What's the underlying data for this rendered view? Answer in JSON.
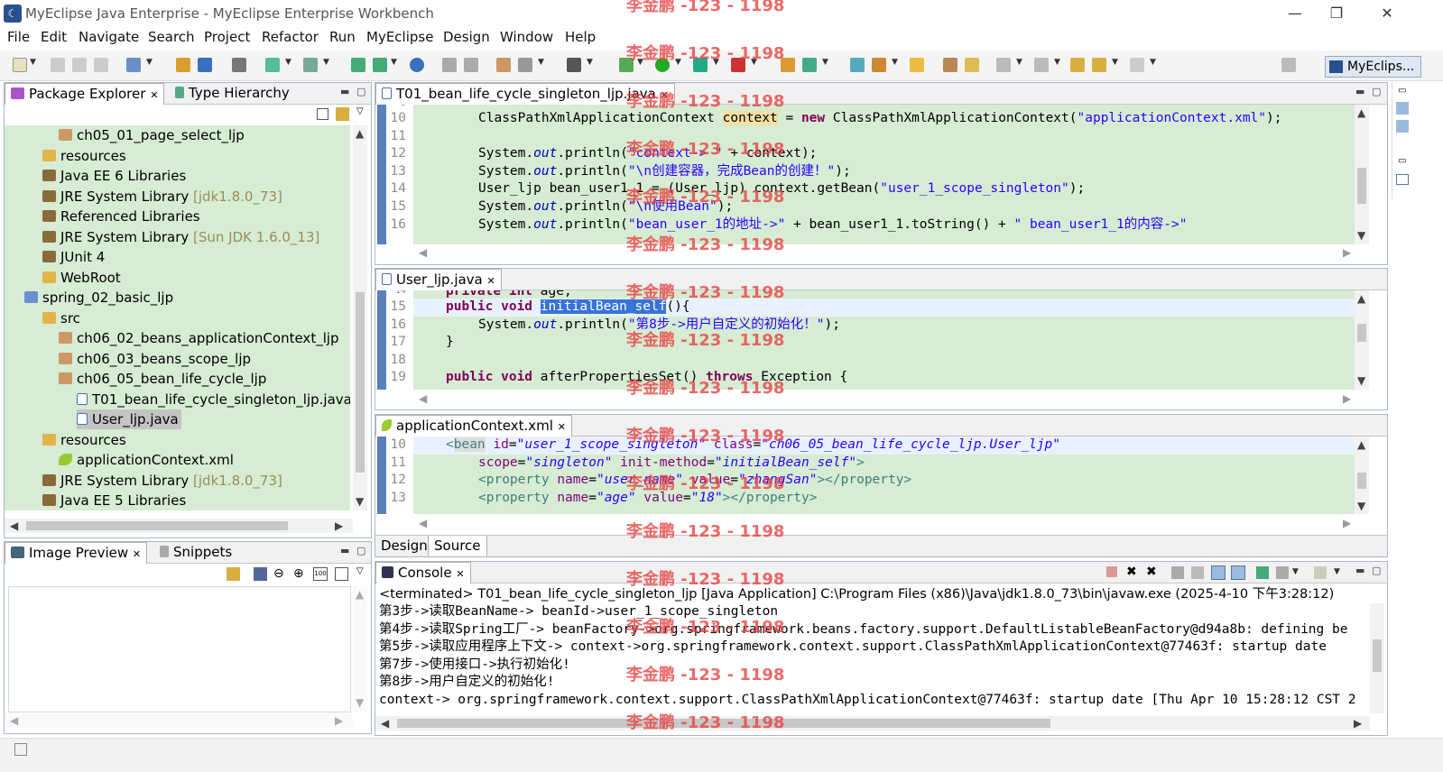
{
  "window": {
    "title": "MyEclipse Java Enterprise - MyEclipse Enterprise Workbench",
    "minimize": "—",
    "restore": "❐",
    "close": "✕"
  },
  "menu": [
    "File",
    "Edit",
    "Navigate",
    "Search",
    "Project",
    "Refactor",
    "Run",
    "MyEclipse",
    "Design",
    "Window",
    "Help"
  ],
  "perspective": "MyEclips...",
  "watermark": "李金鹏 -123 - 1198",
  "explorer": {
    "tabs": [
      "Package Explorer",
      "Type Hierarchy"
    ],
    "items": [
      {
        "label": "ch05_01_page_select_ljp",
        "extra": "",
        "icon": "package"
      },
      {
        "label": "resources",
        "extra": "",
        "icon": "folder"
      },
      {
        "label": "Java EE 6 Libraries",
        "extra": "",
        "icon": "library"
      },
      {
        "label": "JRE System Library",
        "extra": "[jdk1.8.0_73]",
        "icon": "library"
      },
      {
        "label": "Referenced Libraries",
        "extra": "",
        "icon": "library"
      },
      {
        "label": "JRE System Library",
        "extra": "[Sun JDK 1.6.0_13]",
        "icon": "library"
      },
      {
        "label": "JUnit 4",
        "extra": "",
        "icon": "library"
      },
      {
        "label": "WebRoot",
        "extra": "",
        "icon": "folder"
      },
      {
        "label": "spring_02_basic_ljp",
        "extra": "",
        "icon": "project"
      },
      {
        "label": "src",
        "extra": "",
        "icon": "folder"
      },
      {
        "label": "ch06_02_beans_applicationContext_ljp",
        "extra": "",
        "icon": "package"
      },
      {
        "label": "ch06_03_beans_scope_ljp",
        "extra": "",
        "icon": "package"
      },
      {
        "label": "ch06_05_bean_life_cycle_ljp",
        "extra": "",
        "icon": "package"
      },
      {
        "label": "T01_bean_life_cycle_singleton_ljp.java",
        "extra": "",
        "icon": "java"
      },
      {
        "label": "User_ljp.java",
        "extra": "",
        "icon": "java"
      },
      {
        "label": "resources",
        "extra": "",
        "icon": "folder"
      },
      {
        "label": "applicationContext.xml",
        "extra": "",
        "icon": "xml"
      },
      {
        "label": "JRE System Library",
        "extra": "[jdk1.8.0_73]",
        "icon": "library"
      },
      {
        "label": "Java EE 5 Libraries",
        "extra": "",
        "icon": "library"
      }
    ]
  },
  "preview": {
    "tabs": [
      "Image Preview",
      "Snippets"
    ]
  },
  "editor1": {
    "tab": "T01_bean_life_cycle_singleton_ljp.java",
    "lines": [
      "10",
      "11",
      "12",
      "13",
      "14",
      "15",
      "16"
    ],
    "code": [
      "ClassPathXmlApplicationContext context = new ClassPathXmlApplicationContext(\"applicationContext.xml\");",
      "",
      "System.out.println(\"context-> \" + context);",
      "System.out.println(\"\\n创建容器，完成Bean的创建！\");",
      "User_ljp bean_user1_1 = (User_ljp) context.getBean(\"user_1_scope_singleton\");",
      "System.out.println(\"\\n使用Bean\");",
      "System.out.println(\"bean_user_1的地址->\" + bean_user1_1.toString() + \" bean_user1_1的内容->\""
    ]
  },
  "editor2": {
    "tab": "User_ljp.java",
    "lines": [
      "15",
      "16",
      "17",
      "18",
      "19"
    ],
    "code": [
      "public void initialBean_self(){",
      "    System.out.println(\"第8步->用户自定义的初始化！\");",
      "}",
      "",
      "public void afterPropertiesSet() throws Exception {"
    ]
  },
  "editor3": {
    "tab": "applicationContext.xml",
    "lines": [
      "10",
      "11",
      "12",
      "13"
    ],
    "code": [
      "<bean id=\"user_1_scope_singleton\" class=\"ch06_05_bean_life_cycle_ljp.User_ljp\"",
      "    scope=\"singleton\" init-method=\"initialBean_self\">",
      "    <property name=\"user_name\" value=\"zhangSan\"></property>",
      "    <property name=\"age\" value=\"18\"></property>"
    ],
    "bottom_tabs": [
      "Design",
      "Source"
    ]
  },
  "console": {
    "tab": "Console",
    "header": "<terminated> T01_bean_life_cycle_singleton_ljp [Java Application] C:\\Program Files (x86)\\Java\\jdk1.8.0_73\\bin\\javaw.exe (2025-4-10 下午3:28:12)",
    "lines": [
      "第3步->读取BeanName-> beanId->user_1_scope_singleton",
      "第4步->读取Spring工厂-> beanFactory->org.springframework.beans.factory.support.DefaultListableBeanFactory@d94a8b: defining be",
      "第5步->读取应用程序上下文-> context->org.springframework.context.support.ClassPathXmlApplicationContext@77463f: startup date",
      "第7步->使用接口->执行初始化!",
      "第8步->用户自定义的初始化!",
      "context-> org.springframework.context.support.ClassPathXmlApplicationContext@77463f: startup date [Thu Apr 10 15:28:12 CST 2"
    ]
  },
  "colors": {
    "editor_bg": "#d6ecd3",
    "keyword": "#7f0055",
    "string": "#2a00ff",
    "selection": "#3874d8"
  }
}
